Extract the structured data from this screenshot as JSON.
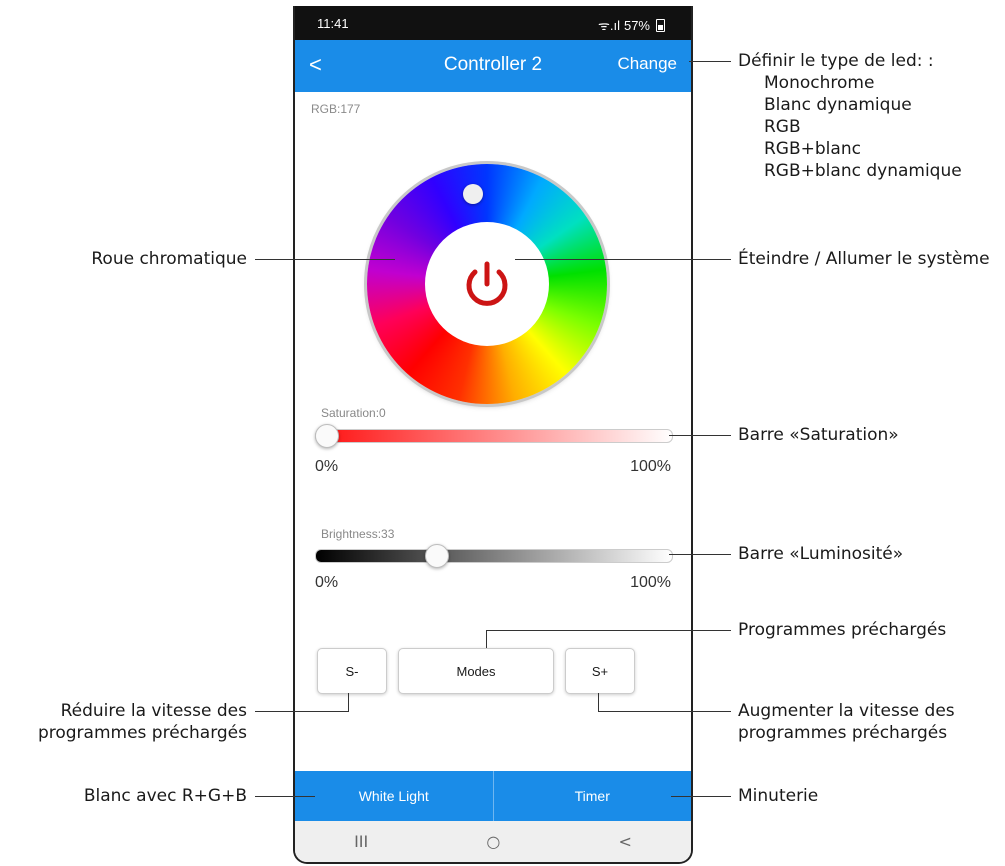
{
  "status": {
    "time": "11:41",
    "signal": "ᯤ.ıl",
    "battery": "57%"
  },
  "appbar": {
    "back": "<",
    "title": "Controller 2",
    "change": "Change"
  },
  "rgb_readout": "RGB:177",
  "saturation": {
    "label": "Saturation:0",
    "min": "0%",
    "max": "100%",
    "value_fraction": 0.0
  },
  "brightness": {
    "label": "Brightness:33",
    "min": "0%",
    "max": "100%",
    "value_fraction": 0.33
  },
  "buttons": {
    "speed_down": "S-",
    "modes": "Modes",
    "speed_up": "S+"
  },
  "bottom": {
    "white_light": "White Light",
    "timer": "Timer"
  },
  "navbar": {
    "recent": "III",
    "home": "○",
    "back": "<"
  },
  "annotations": {
    "led_type_title": "Définir le type de led: :",
    "led_types": [
      "Monochrome",
      "Blanc dynamique",
      "RGB",
      "RGB+blanc",
      "RGB+blanc dynamique"
    ],
    "wheel": "Roue chromatique",
    "power": "Éteindre / Allumer le système",
    "saturation": "Barre «Saturation»",
    "brightness": "Barre «Luminosité»",
    "programs": "Programmes préchargés",
    "speed_down_1": "Réduire la vitesse des",
    "speed_down_2": "programmes préchargés",
    "speed_up_1": "Augmenter la vitesse des",
    "speed_up_2": "programmes préchargés",
    "white": "Blanc avec R+G+B",
    "timer": "Minuterie"
  },
  "colors": {
    "accent": "#1a8ce8",
    "power": "#cc1414"
  }
}
